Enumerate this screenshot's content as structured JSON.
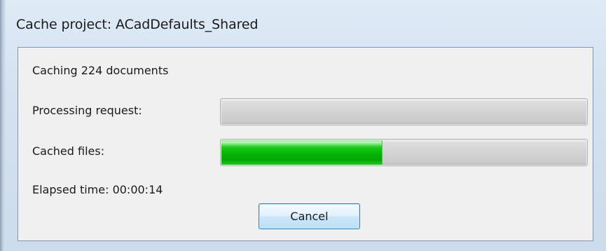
{
  "window": {
    "title": "Cache project: ACadDefaults_Shared"
  },
  "dialog": {
    "status_text": "Caching 224 documents",
    "processing_label": "Processing request:",
    "processing_progress": 0.0,
    "cached_files_label": "Cached files:",
    "cached_files_progress": 0.44,
    "elapsed_time_text": "Elapsed time: 00:00:14",
    "cancel_label": "Cancel"
  },
  "colors": {
    "progress_fill": "#06b006",
    "title_bar": "#dfeaf6",
    "dialog_background": "#f0f0f0",
    "button_border": "#3c7fb1"
  }
}
